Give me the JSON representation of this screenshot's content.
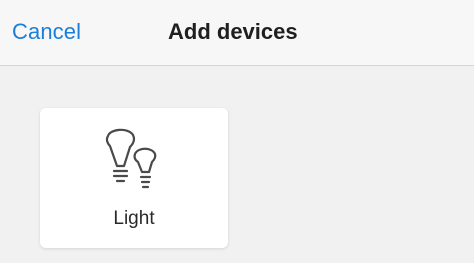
{
  "header": {
    "cancel_label": "Cancel",
    "title": "Add devices"
  },
  "devices": [
    {
      "label": "Light",
      "icon": "light-bulbs-icon"
    }
  ],
  "colors": {
    "accent": "#1a7fd8",
    "background": "#f1f1f2",
    "card": "#ffffff",
    "title": "#1f1f1f"
  }
}
